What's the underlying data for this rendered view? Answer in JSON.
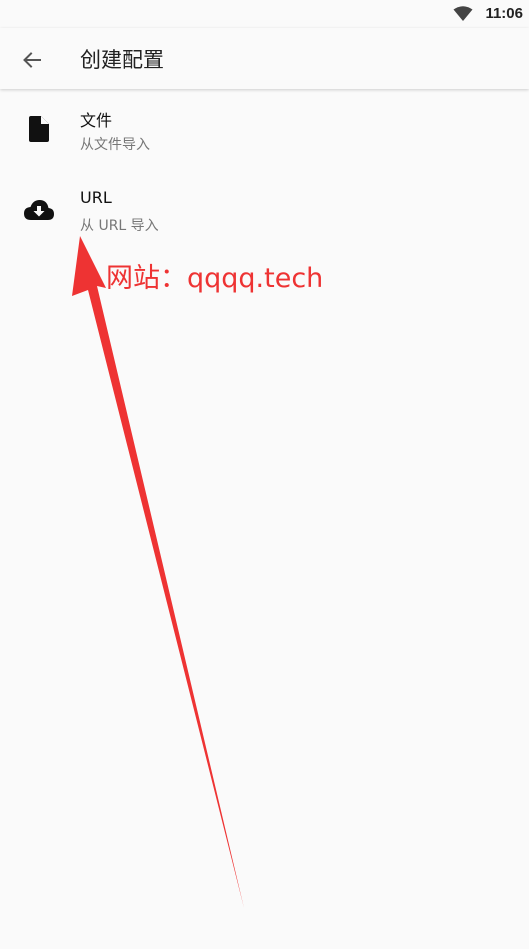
{
  "status_bar": {
    "time": "11:06",
    "wifi_icon": "wifi-icon"
  },
  "app_bar": {
    "back_icon": "arrow-back-icon",
    "title": "创建配置"
  },
  "list": {
    "items": [
      {
        "icon": "file-icon",
        "title": "文件",
        "subtitle": "从文件导入"
      },
      {
        "icon": "cloud-download-icon",
        "title": "URL",
        "subtitle": "从 URL 导入"
      }
    ]
  },
  "overlay": {
    "watermark_text": "网站：qqqq.tech",
    "arrow_icon": "red-arrow-annotation",
    "accent_color": "#ee3333"
  }
}
